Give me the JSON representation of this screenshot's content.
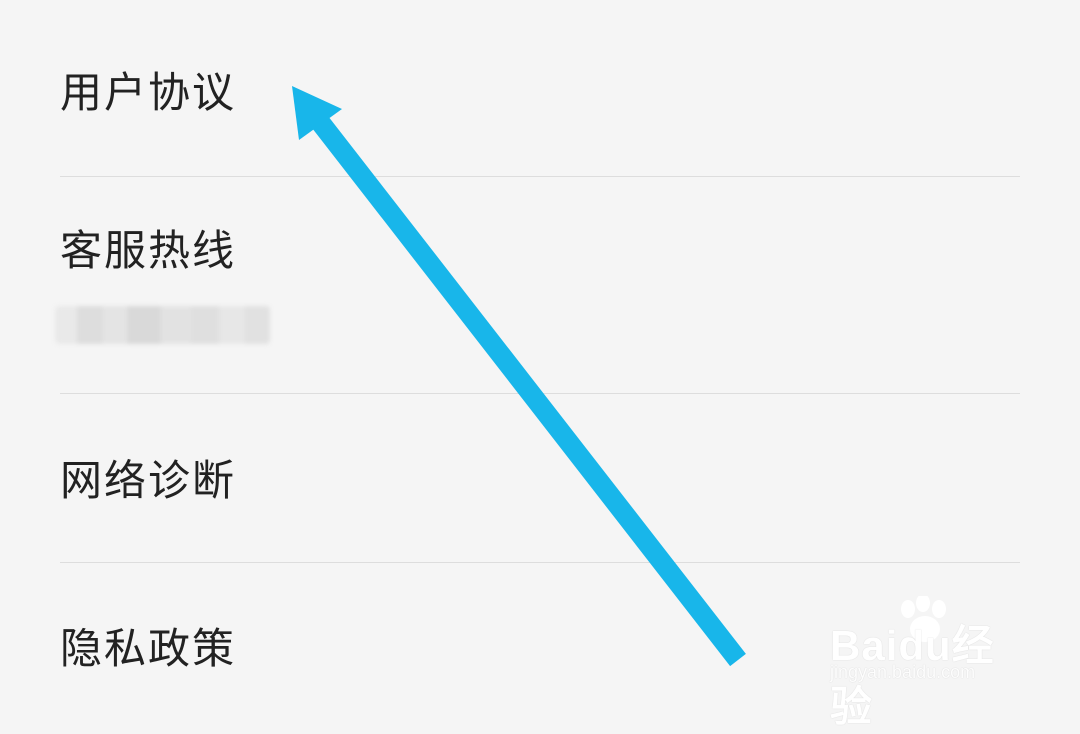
{
  "menu": {
    "items": [
      {
        "label": "用户协议"
      },
      {
        "label": "客服热线"
      },
      {
        "label": "网络诊断"
      },
      {
        "label": "隐私政策"
      }
    ]
  },
  "annotation": {
    "arrow_color": "#18b6ea",
    "icon": "arrow-up-left-icon"
  },
  "watermark": {
    "brand": "Baidu经验",
    "url": "jingyan.baidu.com",
    "icon": "paw-icon"
  },
  "colors": {
    "background": "#f5f5f5",
    "text": "#222222",
    "divider": "#dddddd",
    "accent": "#18b6ea"
  }
}
